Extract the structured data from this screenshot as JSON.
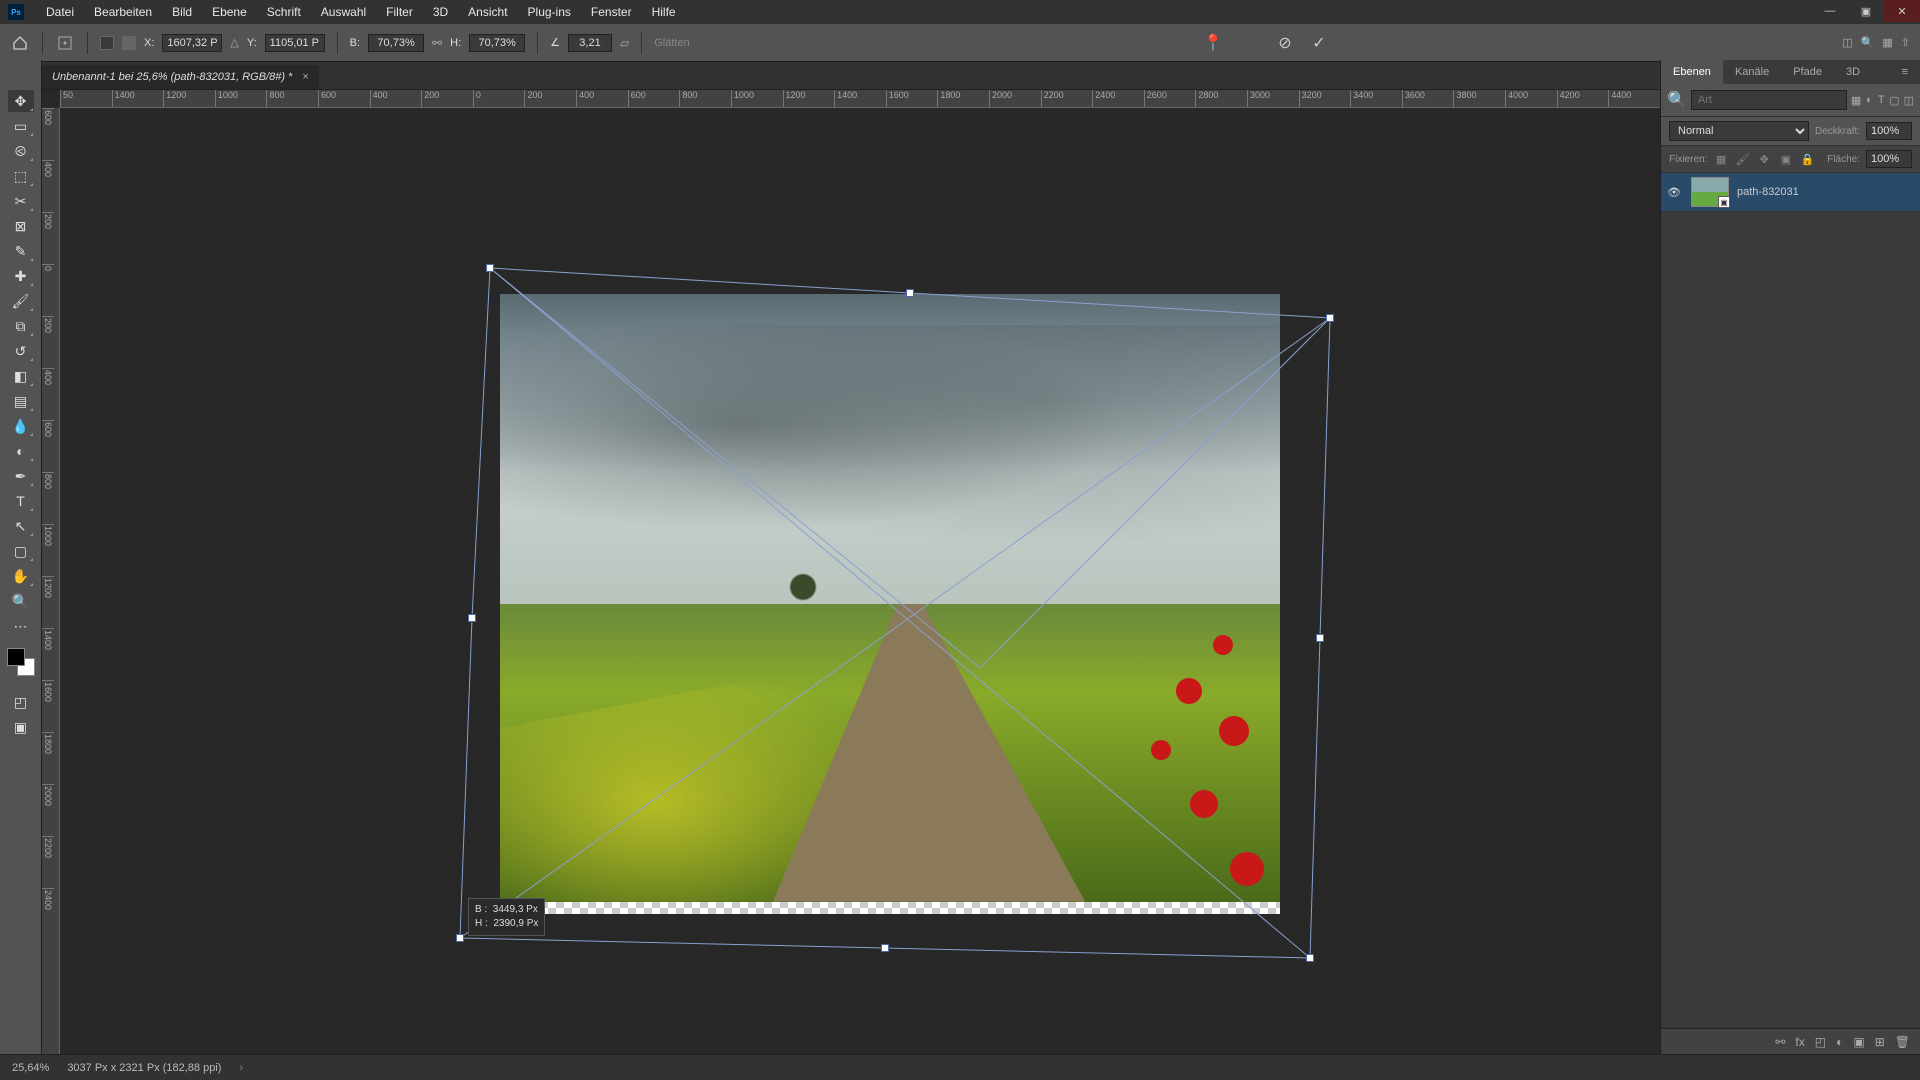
{
  "menu": {
    "items": [
      "Datei",
      "Bearbeiten",
      "Bild",
      "Ebene",
      "Schrift",
      "Auswahl",
      "Filter",
      "3D",
      "Ansicht",
      "Plug-ins",
      "Fenster",
      "Hilfe"
    ]
  },
  "window": {
    "minimize": "—",
    "restore": "▣",
    "close": "✕"
  },
  "options": {
    "x_label": "X:",
    "x_value": "1607,32 P:",
    "y_label": "Y:",
    "y_value": "1105,01 P:",
    "w_label": "B:",
    "w_value": "70,73%",
    "h_label": "H:",
    "h_value": "70,73%",
    "angle_label": "∠",
    "angle_value": "3,21",
    "interp_label": "Glätten",
    "pin": "📍",
    "cancel": "⊘",
    "commit": "✓"
  },
  "document": {
    "tab_title": "Unbenannt-1 bei 25,6% (path-832031, RGB/8#) *",
    "tab_close": "×"
  },
  "ruler_h": [
    "50",
    "1400",
    "1200",
    "1000",
    "800",
    "600",
    "400",
    "200",
    "0",
    "200",
    "400",
    "600",
    "800",
    "1000",
    "1200",
    "1400",
    "1600",
    "1800",
    "2000",
    "2200",
    "2400",
    "2600",
    "2800",
    "3000",
    "3200",
    "3400",
    "3600",
    "3800",
    "4000",
    "4200",
    "4400"
  ],
  "ruler_v": [
    "600",
    "400",
    "200",
    "0",
    "200",
    "400",
    "600",
    "800",
    "1000",
    "1200",
    "1400",
    "1600",
    "1800",
    "2000",
    "2200",
    "2400"
  ],
  "measurement": {
    "w_label": "B :",
    "w_value": "3449,3 Px",
    "h_label": "H :",
    "h_value": "2390,9 Px"
  },
  "panels": {
    "tabs": [
      "Ebenen",
      "Kanäle",
      "Pfade",
      "3D"
    ],
    "search_placeholder": "Art",
    "blend_mode": "Normal",
    "opacity_label": "Deckkraft:",
    "opacity_value": "100%",
    "lock_label": "Fixieren:",
    "fill_label": "Fläche:",
    "fill_value": "100%",
    "layer_name": "path-832031"
  },
  "status": {
    "zoom": "25,64%",
    "doc_info": "3037 Px x 2321 Px (182,88 ppi)",
    "chev": "›"
  }
}
